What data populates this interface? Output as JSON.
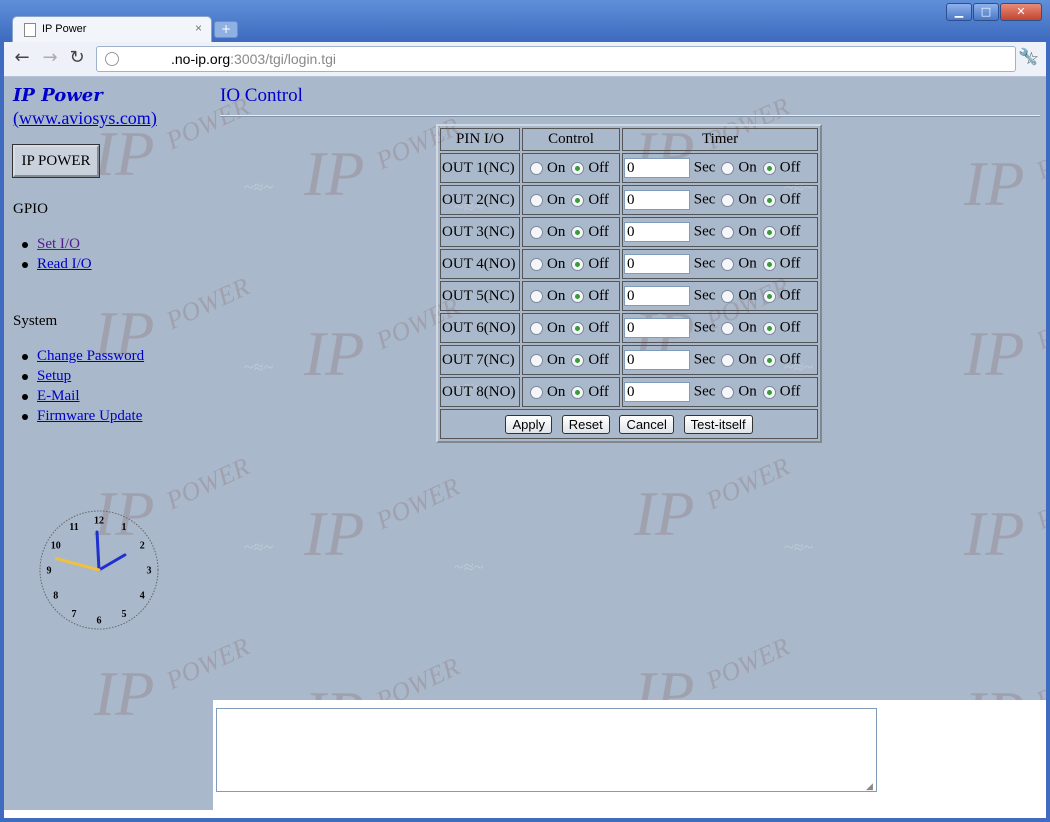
{
  "browser": {
    "tab_title": "IP Power",
    "tab_close": "×",
    "new_tab": "+",
    "window_min": "▁",
    "window_max": "□",
    "window_close": "✕",
    "url_host": ".no-ip.org",
    "url_path": ":3003/tgi/login.tgi",
    "back": "←",
    "forward": "→",
    "reload": "↻",
    "star": "☆",
    "wrench": "🔧"
  },
  "sidebar": {
    "brand_title": "IP Power",
    "brand_link": "(www.aviosys.com)",
    "ip_power_button": "IP POWER",
    "gpio_heading": "GPIO",
    "gpio_links": [
      "Set I/O",
      "Read I/O"
    ],
    "system_heading": "System",
    "system_links": [
      "Change Password",
      "Setup",
      "E-Mail",
      "Firmware Update"
    ]
  },
  "clock": {
    "numbers": [
      "12",
      "1",
      "2",
      "3",
      "4",
      "5",
      "6",
      "7",
      "8",
      "9",
      "10",
      "11"
    ],
    "hour": 1,
    "minute": 59.5,
    "second": 47.5,
    "hand_colors": {
      "hour": "#1f2fd0",
      "minute": "#1f2fd0",
      "second": "#f0c040"
    }
  },
  "main": {
    "heading": "IO Control",
    "table": {
      "headers": [
        "PIN I/O",
        "Control",
        "Timer"
      ],
      "on_label": "On",
      "off_label": "Off",
      "sec_label": "Sec",
      "rows": [
        {
          "pin": "OUT 1(NC)",
          "control": "off",
          "timer": "0",
          "timer_state": "off"
        },
        {
          "pin": "OUT 2(NC)",
          "control": "off",
          "timer": "0",
          "timer_state": "off"
        },
        {
          "pin": "OUT 3(NC)",
          "control": "off",
          "timer": "0",
          "timer_state": "off"
        },
        {
          "pin": "OUT 4(NO)",
          "control": "off",
          "timer": "0",
          "timer_state": "off"
        },
        {
          "pin": "OUT 5(NC)",
          "control": "off",
          "timer": "0",
          "timer_state": "off"
        },
        {
          "pin": "OUT 6(NO)",
          "control": "off",
          "timer": "0",
          "timer_state": "off"
        },
        {
          "pin": "OUT 7(NC)",
          "control": "off",
          "timer": "0",
          "timer_state": "off"
        },
        {
          "pin": "OUT 8(NO)",
          "control": "off",
          "timer": "0",
          "timer_state": "off"
        }
      ],
      "buttons": [
        "Apply",
        "Reset",
        "Cancel",
        "Test-itself"
      ]
    },
    "log_textarea_value": ""
  },
  "watermark": {
    "ip": "IP",
    "power": "POWER"
  }
}
